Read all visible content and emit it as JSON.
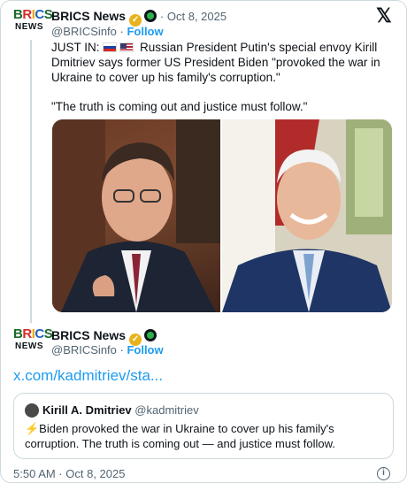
{
  "post": {
    "author_name": "BRICS News",
    "time": "Oct 8, 2025",
    "handle": "@BRICSinfo",
    "follow_label": "Follow",
    "text_prefix": "JUST IN:",
    "text_main": "Russian President Putin's special envoy Kirill Dmitriev says former US President Biden \"provoked the war in Ukraine to cover up his family's corruption.\"",
    "text_quote": "\"The truth is coming out and justice must follow.\""
  },
  "reply": {
    "author_name": "BRICS News",
    "handle": "@BRICSinfo",
    "follow_label": "Follow",
    "link_text": "x.com/kadmitriev/sta...",
    "quoted": {
      "name": "Kirill A. Dmitriev",
      "handle": "@kadmitriev",
      "text": "⚡Biden provoked the war in Ukraine to cover up his family's corruption. The truth is coming out — and justice must follow."
    },
    "timestamp": "5:50 AM · Oct 8, 2025"
  },
  "logo": {
    "line1": "BRICS",
    "line2": "NEWS"
  },
  "colors": {
    "link": "#1d9bf0",
    "muted": "#536471",
    "border": "#cfd9de"
  },
  "icons": [
    "x-logo-icon",
    "verified-badge-icon",
    "affiliate-badge-icon",
    "info-icon"
  ]
}
